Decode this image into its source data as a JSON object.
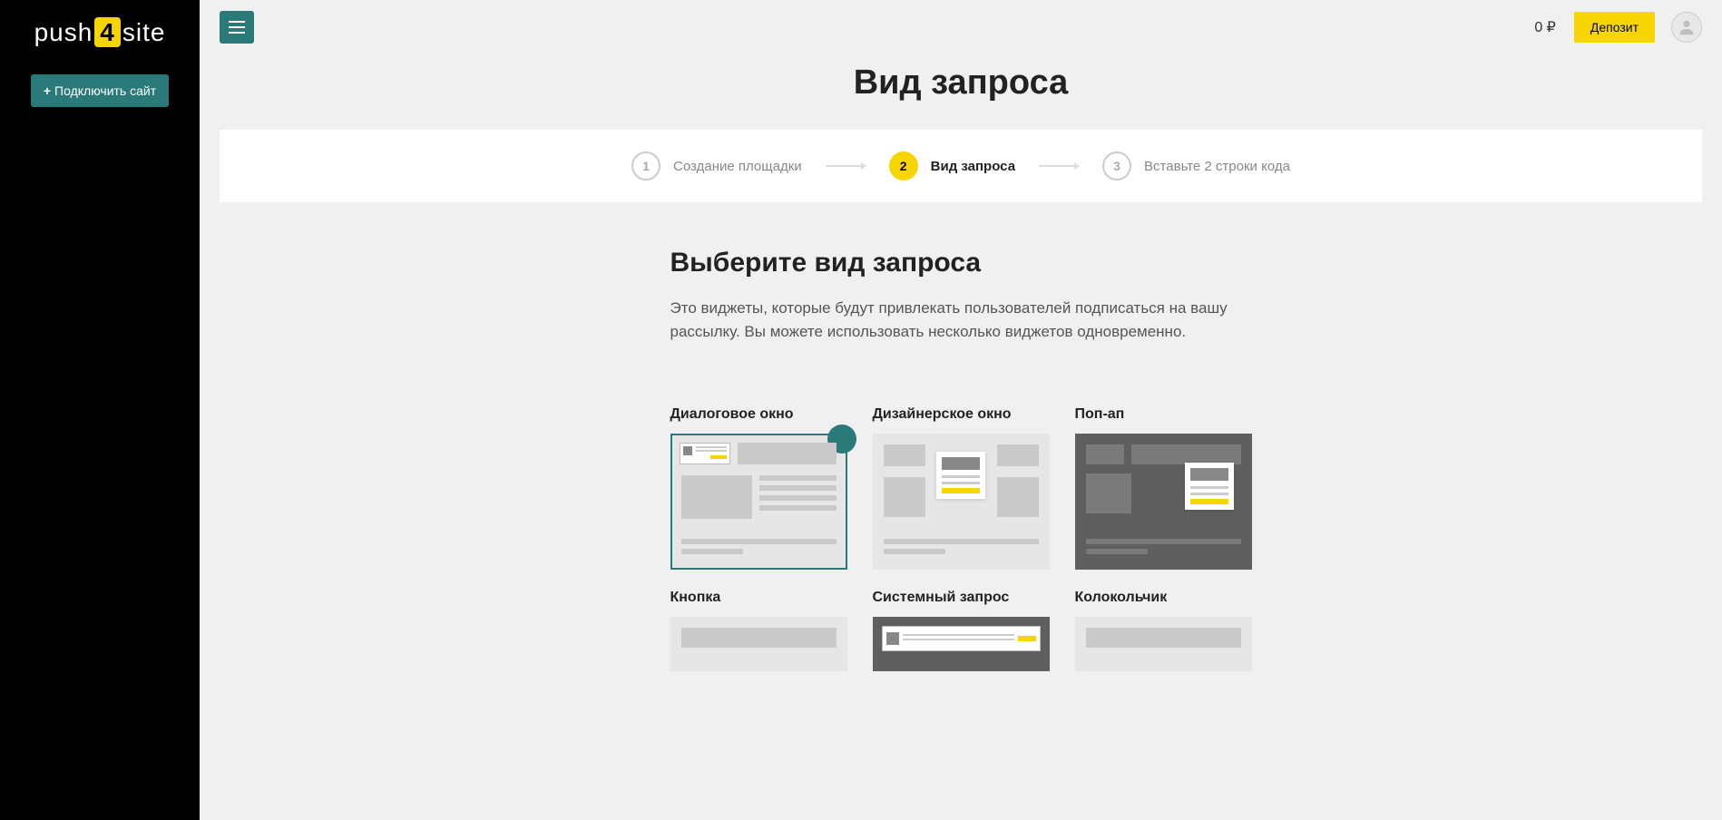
{
  "brand": {
    "part1": "push",
    "badge": "4",
    "part2": "site"
  },
  "sidebar": {
    "connect_label": "Подключить сайт"
  },
  "topbar": {
    "balance": "0 ₽",
    "deposit_label": "Депозит"
  },
  "page": {
    "title": "Вид запроса"
  },
  "steps": [
    {
      "num": "1",
      "label": "Создание площадки",
      "active": false
    },
    {
      "num": "2",
      "label": "Вид запроса",
      "active": true
    },
    {
      "num": "3",
      "label": "Вставьте 2 строки кода",
      "active": false
    }
  ],
  "section": {
    "title": "Выберите вид запроса",
    "desc": "Это виджеты, которые будут привлекать пользователей подписаться на вашу рассылку. Вы можете использовать несколько виджетов одновременно."
  },
  "widgets": {
    "dialog": "Диалоговое окно",
    "designer": "Дизайнерское окно",
    "popup": "Поп-ап",
    "button": "Кнопка",
    "system": "Системный запрос",
    "bell": "Колокольчик"
  },
  "selected_widget": "dialog",
  "colors": {
    "accent": "#f7d500",
    "teal": "#2a7a7a"
  }
}
